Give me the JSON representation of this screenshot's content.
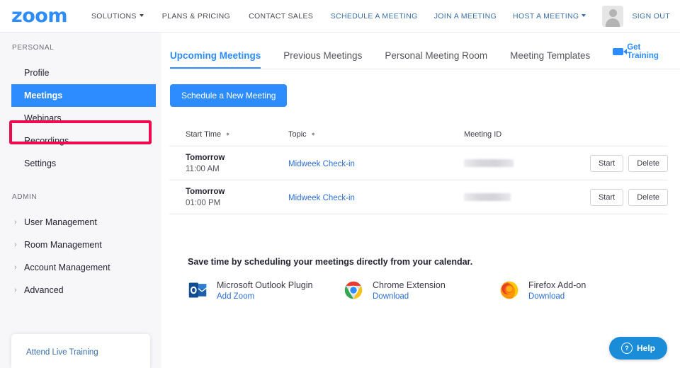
{
  "header": {
    "logo": "zoom",
    "nav_left": [
      {
        "label": "SOLUTIONS",
        "has_caret": true
      },
      {
        "label": "PLANS & PRICING",
        "has_caret": false
      },
      {
        "label": "CONTACT SALES",
        "has_caret": false
      }
    ],
    "nav_right": [
      {
        "label": "SCHEDULE A MEETING",
        "has_caret": false
      },
      {
        "label": "JOIN A MEETING",
        "has_caret": false
      },
      {
        "label": "HOST A MEETING",
        "has_caret": true
      }
    ],
    "sign_out": "SIGN OUT",
    "avatar_icon": "user-avatar-icon"
  },
  "sidebar": {
    "personal_heading": "PERSONAL",
    "personal_items": [
      {
        "label": "Profile",
        "active": false
      },
      {
        "label": "Meetings",
        "active": true
      },
      {
        "label": "Webinars",
        "active": false
      },
      {
        "label": "Recordings",
        "active": false
      },
      {
        "label": "Settings",
        "active": false
      }
    ],
    "admin_heading": "ADMIN",
    "admin_items": [
      {
        "label": "User Management"
      },
      {
        "label": "Room Management"
      },
      {
        "label": "Account Management"
      },
      {
        "label": "Advanced"
      }
    ],
    "training_link": "Attend Live Training",
    "highlight_color": "#ee0a4f",
    "active_color": "#2d8cff"
  },
  "main": {
    "tabs": [
      {
        "label": "Upcoming Meetings",
        "active": true
      },
      {
        "label": "Previous Meetings",
        "active": false
      },
      {
        "label": "Personal Meeting Room",
        "active": false
      },
      {
        "label": "Meeting Templates",
        "active": false
      }
    ],
    "get_training": "Get Training",
    "schedule_button": "Schedule a New Meeting",
    "table": {
      "columns": [
        {
          "label": "Start Time",
          "sortable": true
        },
        {
          "label": "Topic",
          "sortable": true
        },
        {
          "label": "Meeting ID",
          "sortable": false
        }
      ],
      "rows": [
        {
          "day": "Tomorrow",
          "time": "11:00 AM",
          "topic": "Midweek Check-in",
          "meeting_id": "",
          "start_label": "Start",
          "delete_label": "Delete"
        },
        {
          "day": "Tomorrow",
          "time": "01:00 PM",
          "topic": "Midweek Check-in",
          "meeting_id": "",
          "start_label": "Start",
          "delete_label": "Delete"
        }
      ]
    },
    "promo": {
      "title": "Save time by scheduling your meetings directly from your calendar.",
      "items": [
        {
          "icon": "outlook-icon",
          "name": "Microsoft Outlook Plugin",
          "link": "Add Zoom"
        },
        {
          "icon": "chrome-icon",
          "name": "Chrome Extension",
          "link": "Download"
        },
        {
          "icon": "firefox-icon",
          "name": "Firefox Add-on",
          "link": "Download"
        }
      ]
    },
    "help_button": "Help"
  }
}
